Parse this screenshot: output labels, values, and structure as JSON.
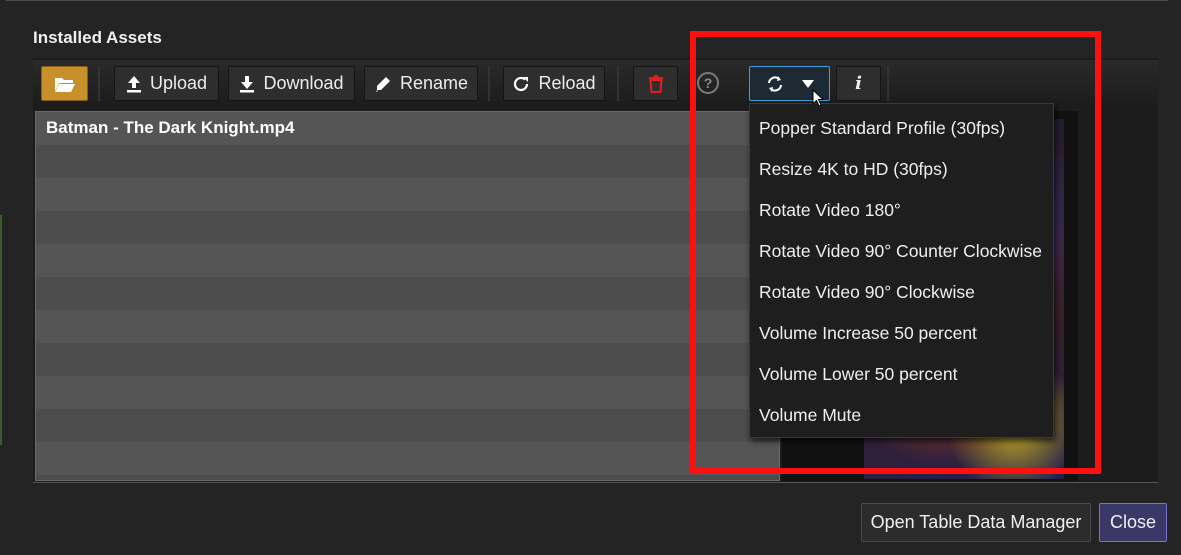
{
  "section": {
    "title": "Installed Assets"
  },
  "toolbar": {
    "upload_label": "Upload",
    "download_label": "Download",
    "rename_label": "Rename",
    "reload_label": "Reload",
    "help_glyph": "?",
    "info_glyph": "i"
  },
  "files": [
    {
      "name": "Batman - The Dark Knight.mp4"
    }
  ],
  "convert_menu": {
    "items": [
      "Popper Standard Profile (30fps)",
      "Resize 4K to HD (30fps)",
      "Rotate Video 180°",
      "Rotate Video 90° Counter Clockwise",
      "Rotate Video 90° Clockwise",
      "Volume Increase 50 percent",
      "Volume Lower 50 percent",
      "Volume Mute"
    ]
  },
  "footer": {
    "open_tdm_label": "Open Table Data Manager",
    "close_label": "Close"
  },
  "colors": {
    "highlight": "#ff1010",
    "folder_button": "#c8902a",
    "active_border": "#3ea0d8",
    "close_button": "#3b3868"
  }
}
